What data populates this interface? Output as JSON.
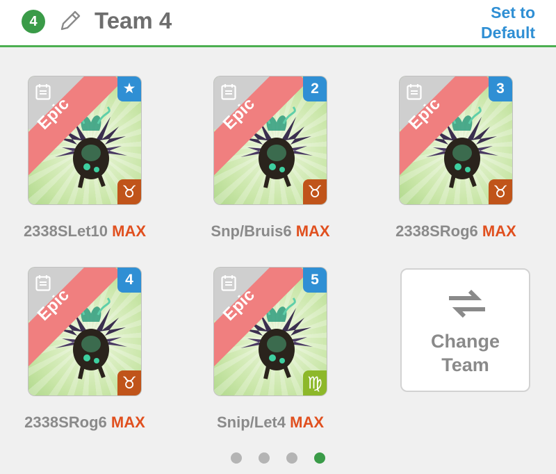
{
  "header": {
    "team_number": "4",
    "team_name": "Team 4",
    "set_default_line1": "Set to",
    "set_default_line2": "Default"
  },
  "cards": [
    {
      "rarity": "Epic",
      "slot": "★",
      "sign": "♉",
      "sign_color": "#c0541a",
      "name": "2338SLet10",
      "level": "MAX"
    },
    {
      "rarity": "Epic",
      "slot": "2",
      "sign": "♉",
      "sign_color": "#c0541a",
      "name": "Snp/Bruis6",
      "level": "MAX"
    },
    {
      "rarity": "Epic",
      "slot": "3",
      "sign": "♉",
      "sign_color": "#c0541a",
      "name": "2338SRog6",
      "level": "MAX"
    },
    {
      "rarity": "Epic",
      "slot": "4",
      "sign": "♉",
      "sign_color": "#c0541a",
      "name": "2338SRog6",
      "level": "MAX"
    },
    {
      "rarity": "Epic",
      "slot": "5",
      "sign": "♍",
      "sign_color": "#8db82a",
      "name": "Snip/Let4",
      "level": "MAX"
    }
  ],
  "change_team": {
    "line1": "Change",
    "line2": "Team"
  },
  "pagination": {
    "total": 4,
    "active_index": 3
  },
  "colors": {
    "accent_green": "#3a9b48",
    "link_blue": "#2f8fd4",
    "max_orange": "#e0501f",
    "epic_red": "#f07f7f"
  }
}
